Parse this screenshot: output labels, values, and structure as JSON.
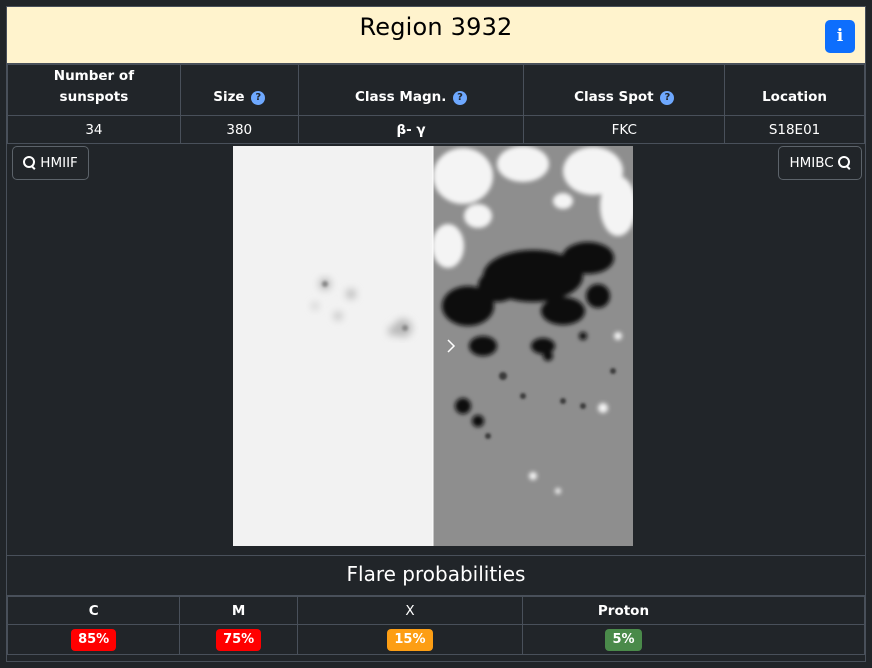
{
  "region": {
    "title": "Region 3932",
    "info_icon": "i"
  },
  "colors": {
    "header_bg": "#fff3cd",
    "info_button": "#0d6efd",
    "magnetic_class": "#fd9e14"
  },
  "properties": {
    "headers": {
      "num_sunspots": "Number of sunspots",
      "size": "Size",
      "class_magn": "Class Magn.",
      "class_spot": "Class Spot",
      "location": "Location"
    },
    "help_icon": "?",
    "values": {
      "num_sunspots": "34",
      "size": "380",
      "class_magn": "β- γ",
      "class_spot": "FKC",
      "location": "S18E01"
    }
  },
  "viewer": {
    "left_button": "HMIIF",
    "right_button": "HMIBC",
    "left_icon": "zoom-in-icon",
    "right_icon": "zoom-in-icon",
    "divider_icon": "chevron-right-icon"
  },
  "flare": {
    "title": "Flare probabilities",
    "headers": {
      "c": "C",
      "m": "M",
      "x": "X",
      "proton": "Proton"
    },
    "values": {
      "c": "85%",
      "m": "75%",
      "x": "15%",
      "proton": "5%"
    },
    "colors": {
      "c": "#ff0000",
      "m": "#ff0000",
      "x": "#fd9e14",
      "proton": "#4a8a4a"
    }
  }
}
